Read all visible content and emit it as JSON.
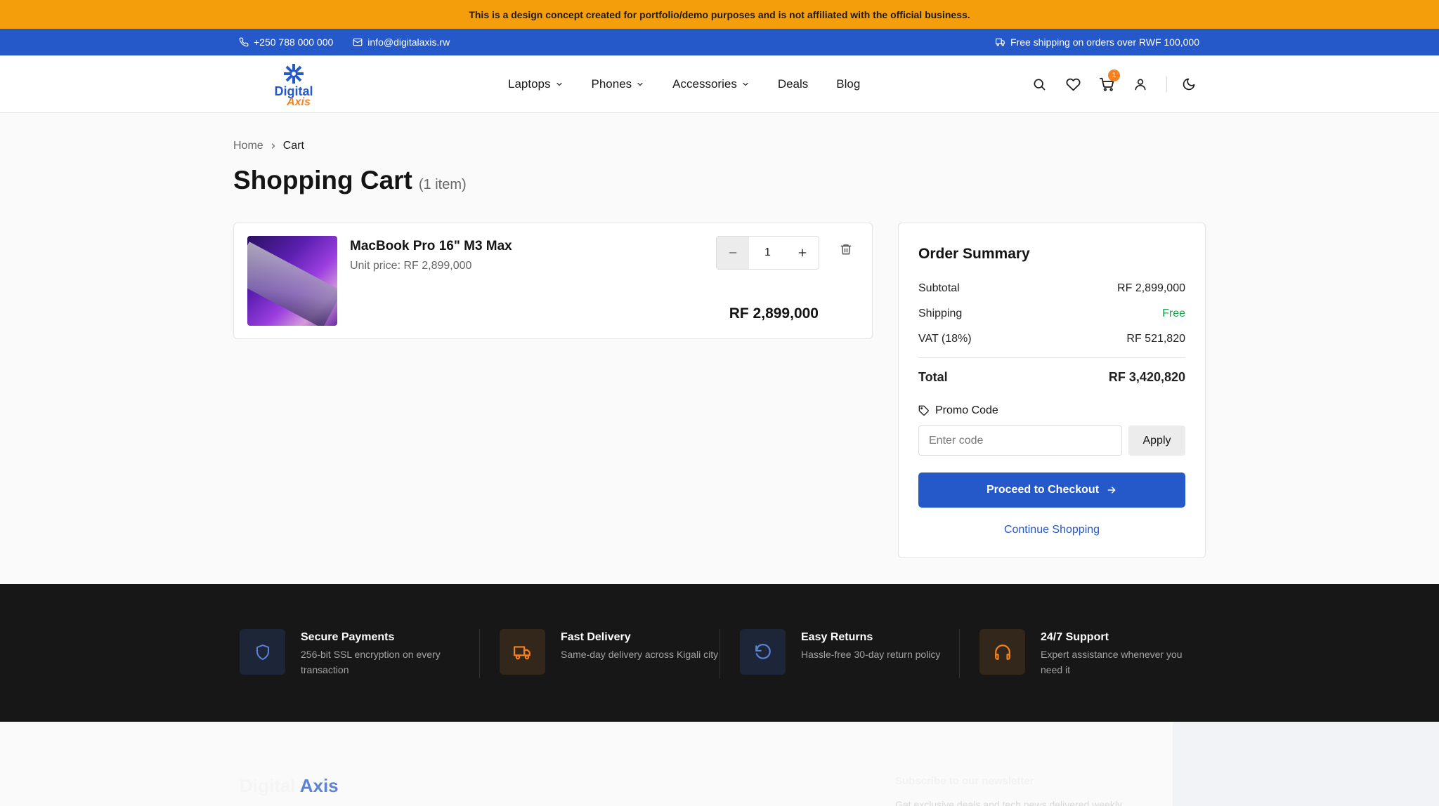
{
  "notice": {
    "text": "This is a design concept created for portfolio/demo purposes and is not affiliated with the official business."
  },
  "topbar": {
    "phone": "+250 788 000 000",
    "email": "info@digitalaxis.rw",
    "shipping": "Free shipping on orders over RWF 100,000"
  },
  "brand": {
    "line1": "Digital",
    "line2": "Axis"
  },
  "nav": [
    {
      "label": "Laptops",
      "dropdown": true
    },
    {
      "label": "Phones",
      "dropdown": true
    },
    {
      "label": "Accessories",
      "dropdown": true
    },
    {
      "label": "Deals",
      "dropdown": false
    },
    {
      "label": "Blog",
      "dropdown": false
    }
  ],
  "header_icons": [
    "search-icon",
    "heart-icon",
    "cart-icon",
    "user-icon",
    "moon-icon"
  ],
  "cart_badge": "1",
  "breadcrumb": {
    "home": "Home",
    "current": "Cart"
  },
  "page": {
    "title": "Shopping Cart",
    "count": "(1 item)"
  },
  "cart_item": {
    "name": "MacBook Pro 16\" M3 Max",
    "unit_price": "Unit price: RF 2,899,000",
    "quantity": "1",
    "line_total": "RF 2,899,000"
  },
  "summary": {
    "title": "Order Summary",
    "subtotal_label": "Subtotal",
    "subtotal_value": "RF 2,899,000",
    "shipping_label": "Shipping",
    "shipping_value": "Free",
    "vat_label": "VAT (18%)",
    "vat_value": "RF 521,820",
    "total_label": "Total",
    "total_value": "RF 3,420,820",
    "promo_label": "Promo Code",
    "promo_placeholder": "Enter code",
    "apply_label": "Apply",
    "checkout_label": "Proceed to Checkout",
    "continue_label": "Continue Shopping"
  },
  "features": [
    {
      "title": "Secure Payments",
      "desc": "256-bit SSL encryption on every transaction",
      "icon": "shield-icon"
    },
    {
      "title": "Fast Delivery",
      "desc": "Same-day delivery across Kigali city",
      "icon": "truck-icon"
    },
    {
      "title": "Easy Returns",
      "desc": "Hassle-free 30-day return policy",
      "icon": "rotate-ccw-icon"
    },
    {
      "title": "24/7 Support",
      "desc": "Expert assistance whenever you need it",
      "icon": "headphones-icon"
    }
  ],
  "footer": {
    "logo_a": "Digital",
    "logo_b": "Axis",
    "newsletter_title": "Subscribe to our newsletter",
    "newsletter_desc": "Get exclusive deals and tech news delivered weekly"
  },
  "colors": {
    "primary": "#2558c9",
    "accent": "#f5821f",
    "notice": "#f59e0b",
    "success": "#16a34a",
    "dark": "#171717"
  }
}
